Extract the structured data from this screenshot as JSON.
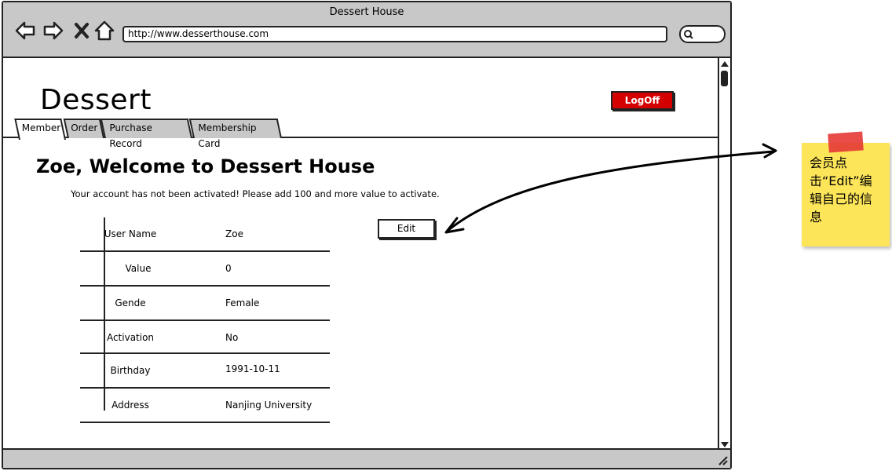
{
  "window": {
    "title": "Dessert House",
    "url": "http://www.desserthouse.com"
  },
  "page": {
    "site_title": "Dessert",
    "logoff_label": "LogOff",
    "tabs": [
      {
        "label": "Member",
        "active": true
      },
      {
        "label": "Order",
        "active": false
      },
      {
        "label": "Purchase Record",
        "active": false
      },
      {
        "label": "Membership Card",
        "active": false
      }
    ],
    "welcome": "Zoe, Welcome to Dessert House",
    "notice": "Your account has not been activated! Please add 100 and more value to activate.",
    "edit_label": "Edit",
    "info": [
      {
        "label": "User Name",
        "value": "Zoe"
      },
      {
        "label": "Value",
        "value": "0"
      },
      {
        "label": "Gende",
        "value": "Female"
      },
      {
        "label": "Activation",
        "value": "No"
      },
      {
        "label": "Birthday",
        "value": "1991-10-11"
      },
      {
        "label": "Address",
        "value": "Nanjing University"
      }
    ]
  },
  "annotation": {
    "note": "会员点击“Edit”编辑自己的信息",
    "color": "#fde55a"
  },
  "colors": {
    "frame": "#c8c8c8",
    "logoff_bg": "#d40000"
  },
  "icons": [
    "back-arrow-icon",
    "forward-arrow-icon",
    "close-icon",
    "home-icon",
    "search-icon"
  ]
}
